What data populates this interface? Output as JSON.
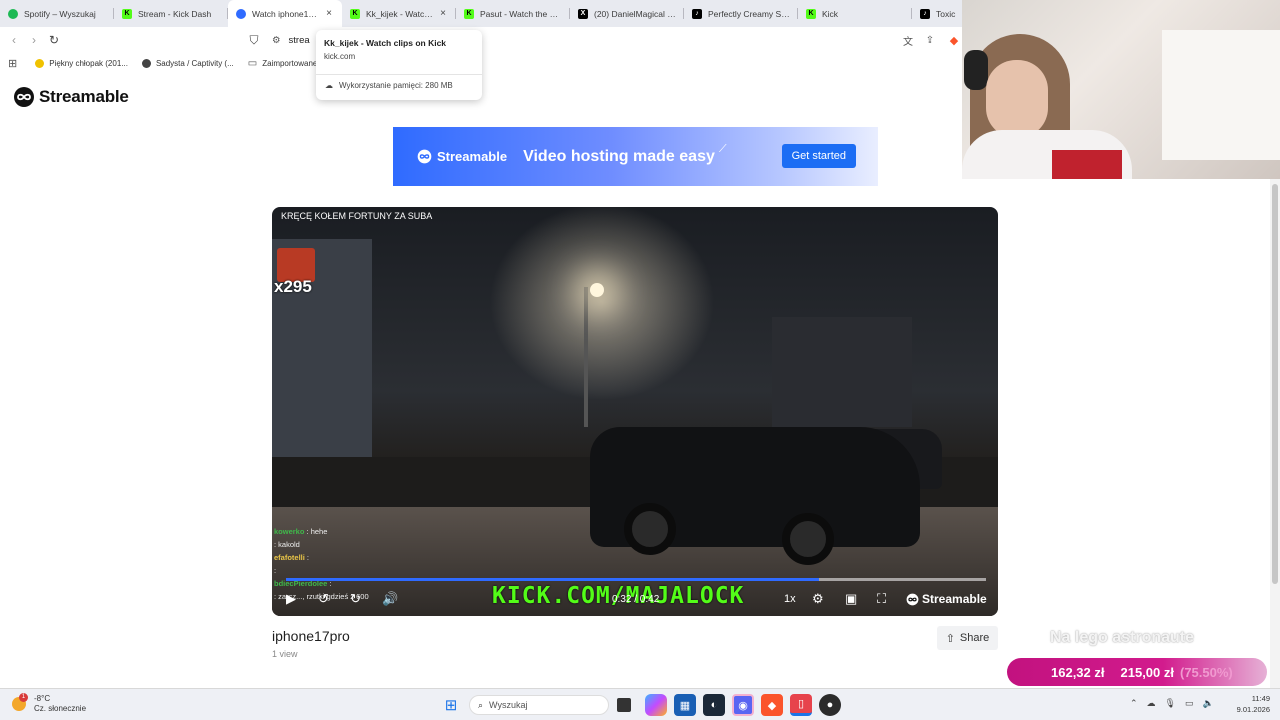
{
  "browser": {
    "tabs": [
      {
        "title": "Spotify – Wyszukaj",
        "icon": "spotify-icon",
        "color": "#1db954",
        "active": false
      },
      {
        "title": "Stream - Kick Dash",
        "icon": "kick-icon",
        "color": "#53fc18",
        "active": false
      },
      {
        "title": "Watch iphone17pro",
        "icon": "streamable-icon",
        "color": "#2f6bff",
        "active": true
      },
      {
        "title": "Kk_kijek - Watch c",
        "icon": "kick-icon",
        "color": "#53fc18",
        "active": false
      },
      {
        "title": "Pasut - Watch the VOD",
        "icon": "kick-icon",
        "color": "#53fc18",
        "active": false
      },
      {
        "title": "(20) DanielMagical (@",
        "icon": "x-icon",
        "color": "#000000",
        "active": false
      },
      {
        "title": "Perfectly Creamy Stari",
        "icon": "tiktok-icon",
        "color": "#000000",
        "active": false
      },
      {
        "title": "Kick",
        "icon": "kick-icon",
        "color": "#53fc18",
        "active": false
      },
      {
        "title": "Toxic",
        "icon": "tiktok-icon",
        "color": "#000000",
        "active": false
      }
    ],
    "url_partial": "strea",
    "bookmarks": [
      {
        "label": "Piękny chłopak (201...",
        "icon": "bookmark-icon"
      },
      {
        "label": "Sadysta / Captivity (...",
        "icon": "globe-icon"
      },
      {
        "label": "Zaimportowane",
        "icon": "folder-icon"
      }
    ],
    "tooltip": {
      "title": "Kk_kijek - Watch clips on Kick",
      "domain": "kick.com",
      "memory": "Wykorzystanie pamięci: 280 MB"
    }
  },
  "page": {
    "logo": "Streamable",
    "banner": {
      "logo": "Streamable",
      "headline": "Video hosting made easy",
      "cta": "Get started"
    },
    "video": {
      "overlay_title": "KRĘCĘ KOŁEM FORTUNY ZA SUBA",
      "combo": "x295",
      "chat": [
        {
          "user": "kowerko",
          "msg": "hehe"
        },
        {
          "user": "",
          "msg": "kakold"
        },
        {
          "user": "efafotelli",
          "msg": ""
        },
        {
          "user": "",
          "msg": ""
        },
        {
          "user": "bdiecPierdolee",
          "msg": ""
        },
        {
          "user": "",
          "msg": "zarcz..., rzutki gdzieś z 600"
        }
      ],
      "watermark": "KICK.COM/MAJALOCK",
      "time": "0:32 / 0:42",
      "progress": 0.762,
      "speed": "1x",
      "brand": "Streamable"
    },
    "title": "iphone17pro",
    "views": "1 view",
    "share_label": "Share"
  },
  "stream_overlay": {
    "caption": "Na lego astronaute",
    "goal_current": "162,32 zł",
    "goal_target": "215,00 zł",
    "goal_percent": "(75.50%)"
  },
  "taskbar": {
    "weather_temp": "-8°C",
    "weather_desc": "Cz. słonecznie",
    "weather_badge": "1",
    "search_placeholder": "Wyszukaj",
    "time": "11:49",
    "date": "9.01.2026"
  },
  "colors": {
    "streamable_blue": "#2f6bff",
    "kick_green": "#53fc18",
    "pill_magenta": "#c2127f"
  }
}
